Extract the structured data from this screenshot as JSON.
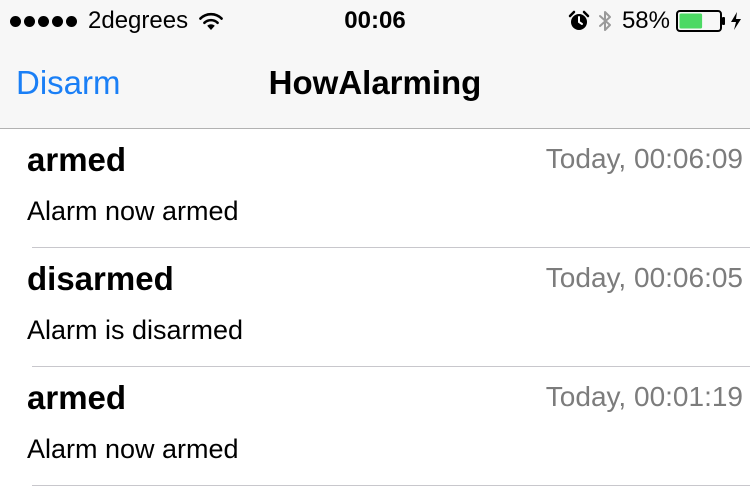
{
  "status_bar": {
    "signal_bars": 5,
    "carrier": "2degrees",
    "time": "00:06",
    "battery_percent": "58%",
    "battery_level": 0.58,
    "battery_color": "#4cd964",
    "icons": [
      "wifi-icon",
      "alarm-clock-icon",
      "bluetooth-icon",
      "battery-icon",
      "charging-bolt-icon"
    ]
  },
  "nav": {
    "left_button": "Disarm",
    "title": "HowAlarming",
    "tint_color": "#1a7ff6"
  },
  "events": [
    {
      "title": "armed",
      "time": "Today, 00:06:09",
      "detail": "Alarm now armed"
    },
    {
      "title": "disarmed",
      "time": "Today, 00:06:05",
      "detail": "Alarm is disarmed"
    },
    {
      "title": "armed",
      "time": "Today, 00:01:19",
      "detail": "Alarm now armed"
    }
  ]
}
